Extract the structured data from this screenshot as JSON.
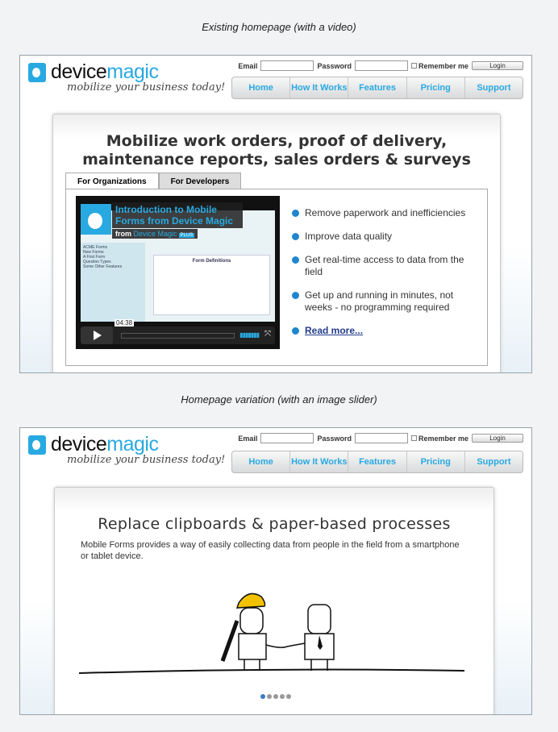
{
  "captions": [
    "Existing homepage (with a video)",
    "Homepage variation (with an image slider)"
  ],
  "brand": {
    "logo_bold": "device",
    "logo_light": "magic",
    "tagline": "mobilize your business today!",
    "accent": "#29a9e1"
  },
  "login": {
    "email_label": "Email",
    "password_label": "Password",
    "remember_label": "Remember me",
    "login_button": "Login"
  },
  "nav": [
    "Home",
    "How It Works",
    "Features",
    "Pricing",
    "Support"
  ],
  "existing": {
    "headline": "Mobilize work orders, proof of delivery, maintenance reports, sales orders & surveys",
    "tabs": [
      "For Organizations",
      "For Developers"
    ],
    "video": {
      "title": "Introduction to Mobile Forms from Device Magic",
      "from": "from",
      "author": "Device Magic",
      "badge": "PLUS",
      "duration": "04:38",
      "screen_heading": "Form Definitions",
      "sidebar_title": "ACME Forms",
      "sidebar_items": [
        "New Forms",
        "A First Form",
        "Question Types",
        "Some Other Features"
      ]
    },
    "bullets": [
      "Remove paperwork and inefficiencies",
      "Improve data quality",
      "Get real-time access to data from the field",
      "Get up and running in minutes, not weeks - no programming required"
    ],
    "read_more": "Read more..."
  },
  "variation": {
    "headline": "Replace clipboards & paper-based processes",
    "description": "Mobile Forms provides a way of easily collecting data from people in the field from a smartphone or tablet device.",
    "slider": {
      "slides": 5,
      "active": 1
    }
  }
}
